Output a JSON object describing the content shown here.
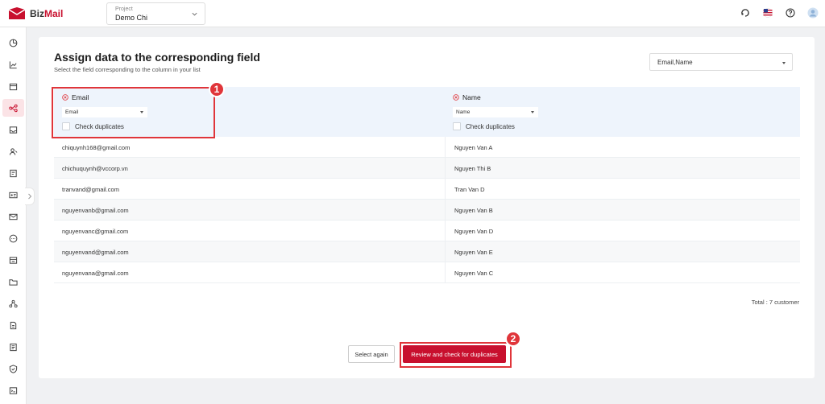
{
  "app": {
    "brand_part1": "Biz",
    "brand_part2": "Mail",
    "brand_color": "#c8102e"
  },
  "header": {
    "project_label": "Project",
    "project_value": "Demo Chi",
    "icons": [
      "support-icon",
      "us-flag-icon",
      "help-icon",
      "avatar"
    ]
  },
  "sidebar": {
    "icons": [
      "dashboard-icon",
      "chart-icon",
      "calendar-icon",
      "workflow-icon",
      "inbox-icon",
      "contacts-icon",
      "form-icon",
      "id-card-icon",
      "mail-icon",
      "chat-icon",
      "template-icon",
      "folder-icon",
      "network-icon",
      "file-icon",
      "document-icon",
      "shield-icon",
      "terminal-icon"
    ],
    "active_index": 3
  },
  "main": {
    "title": "Assign data to the corresponding field",
    "subtitle": "Select the field corresponding to the column in your list",
    "fields_select_value": "Email,Name",
    "columns": [
      {
        "name": "Email",
        "selected": "Email",
        "check_label": "Check duplicates"
      },
      {
        "name": "Name",
        "selected": "Name",
        "check_label": "Check duplicates"
      }
    ],
    "rows": [
      [
        "chiquynh168@gmail.com",
        "Nguyen Van A"
      ],
      [
        "chichuquynh@vccorp.vn",
        "Nguyen Thi B"
      ],
      [
        "tranvand@gmail.com",
        "Tran Van D"
      ],
      [
        "nguyenvanb@gmail.com",
        "Nguyen Van B"
      ],
      [
        "nguyenvanc@gmail.com",
        "Nguyen Van D"
      ],
      [
        "nguyenvand@gmail.com",
        "Nguyen Van E"
      ],
      [
        "nguyenvana@gmail.com",
        "Nguyen Van C"
      ]
    ],
    "total": "Total : 7 customer",
    "select_again_label": "Select again",
    "review_label": "Review and check for duplicates"
  },
  "annotations": {
    "badge1": "1",
    "badge2": "2",
    "color": "#e0353a"
  }
}
